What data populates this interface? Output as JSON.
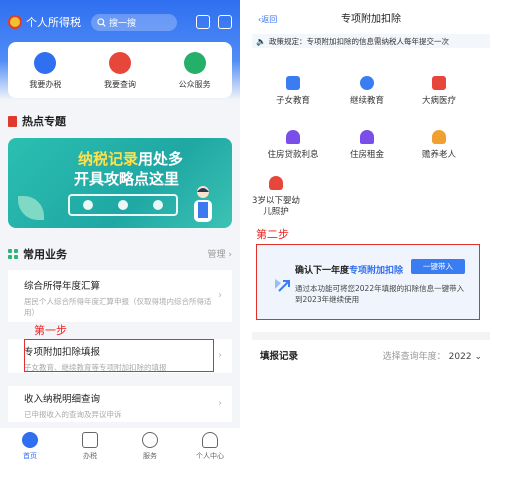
{
  "left": {
    "app_name": "个人所得税",
    "search_placeholder": "搜一搜",
    "services": [
      {
        "label": "我要办税",
        "icon": "pen-icon",
        "color": "#2f6ff0"
      },
      {
        "label": "我要查询",
        "icon": "search-icon",
        "color": "#e7473a"
      },
      {
        "label": "公众服务",
        "icon": "service-icon",
        "color": "#25b06a"
      }
    ],
    "hot_title": "热点专题",
    "banner": {
      "line1_highlight": "纳税记录",
      "line1_rest": "用处多",
      "line2": "开具攻略点这里"
    },
    "common_title": "常用业务",
    "manage_label": "管理",
    "business": [
      {
        "title": "综合所得年度汇算",
        "desc": "居民个人综合所得年度汇算申报（仅取得境内综合所得适用）"
      },
      {
        "title": "专项附加扣除填报",
        "desc": "子女教育、继续教育等专项附加扣除的填报"
      },
      {
        "title": "收入纳税明细查询",
        "desc": "已申报收入的查询及异议申诉"
      }
    ],
    "step1": "第一步",
    "tabs": [
      {
        "label": "首页",
        "icon": "home-icon",
        "active": true
      },
      {
        "label": "办税",
        "icon": "document-icon",
        "active": false
      },
      {
        "label": "服务",
        "icon": "heart-icon",
        "active": false
      },
      {
        "label": "个人中心",
        "icon": "person-icon",
        "active": false
      }
    ],
    "accent": "#2f6ff0"
  },
  "right": {
    "back_label": "返回",
    "title": "专项附加扣除",
    "notice": "政策规定：专项附加扣除的信息需纳税人每年提交一次",
    "items": [
      {
        "label": "子女教育",
        "icon": "children-icon",
        "color": "#3a7cf2"
      },
      {
        "label": "继续教育",
        "icon": "graduation-cap-icon",
        "color": "#3a7cf2"
      },
      {
        "label": "大病医疗",
        "icon": "medical-kit-icon",
        "color": "#e7473a"
      },
      {
        "label": "住房贷款利息",
        "icon": "house-icon",
        "color": "#7a4ee8"
      },
      {
        "label": "住房租金",
        "icon": "rent-house-icon",
        "color": "#7a4ee8"
      },
      {
        "label": "赡养老人",
        "icon": "elderly-icon",
        "color": "#f0a030"
      },
      {
        "label": "3岁以下婴幼儿照护",
        "icon": "baby-icon",
        "color": "#e7473a"
      }
    ],
    "step2": "第二步",
    "confirm": {
      "title_prefix": "确认下一年度",
      "title_highlight": "专项附加扣除",
      "button": "一键带入",
      "desc": "通过本功能可将您2022年填报的扣除信息一键带入到2023年继续使用"
    },
    "record_title": "填报记录",
    "year_label": "选择查询年度：",
    "year_value": "2022"
  }
}
